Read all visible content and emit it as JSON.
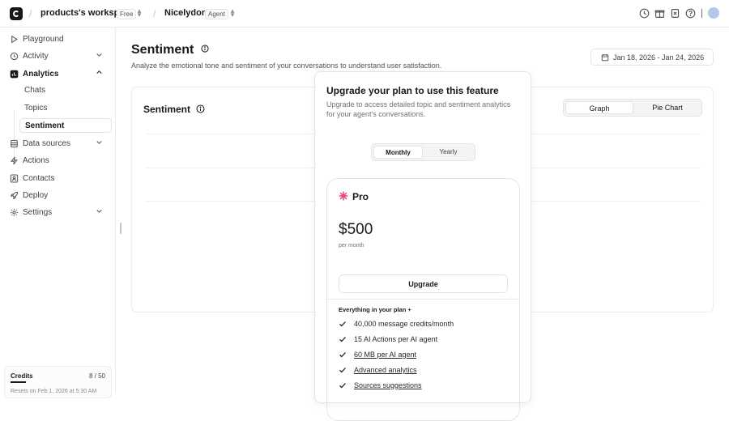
{
  "topbar": {
    "workspace": "products's workspace",
    "workspace_badge": "Free",
    "agent": "Nicelydone",
    "agent_badge": "Agent"
  },
  "sidebar": {
    "items": [
      {
        "label": "Playground",
        "icon": "play-icon"
      },
      {
        "label": "Activity",
        "icon": "activity-icon"
      },
      {
        "label": "Analytics",
        "icon": "chart-icon"
      },
      {
        "label": "Data sources",
        "icon": "database-icon"
      },
      {
        "label": "Actions",
        "icon": "actions-icon"
      },
      {
        "label": "Contacts",
        "icon": "contacts-icon"
      },
      {
        "label": "Deploy",
        "icon": "rocket-icon"
      },
      {
        "label": "Settings",
        "icon": "gear-icon"
      }
    ],
    "analytics_sub": [
      "Chats",
      "Topics",
      "Sentiment"
    ],
    "credits": {
      "label": "Credits",
      "value": "8 / 50",
      "used_fraction": 0.16,
      "reset": "Resets on Feb 1, 2026 at 5:30 AM"
    }
  },
  "page": {
    "title": "Sentiment",
    "subtitle": "Analyze the emotional tone and sentiment of your conversations to understand user satisfaction.",
    "date_range": "Jan 18, 2026 - Jan 24, 2026"
  },
  "card": {
    "title": "Sentiment",
    "tabs": [
      "Graph",
      "Pie Chart"
    ],
    "active_tab": "Graph"
  },
  "modal": {
    "title": "Upgrade your plan to use this feature",
    "subtitle": "Upgrade to access detailed topic and sentiment analytics for your agent's conversations.",
    "period": [
      "Monthly",
      "Yearly"
    ],
    "active_period": "Monthly",
    "plan": {
      "name": "Pro",
      "price": "$500",
      "per": "per month",
      "button": "Upgrade",
      "features_head": "Everything in your plan +",
      "features": [
        "40,000 message credits/month",
        "15 AI Actions per AI agent",
        "60 MB per AI agent",
        "Advanced analytics",
        "Sources suggestions"
      ]
    }
  },
  "colors": {
    "accent_pink": "#e6457a",
    "text": "#18181b",
    "muted": "#71717a",
    "border": "#e4e4e7"
  }
}
